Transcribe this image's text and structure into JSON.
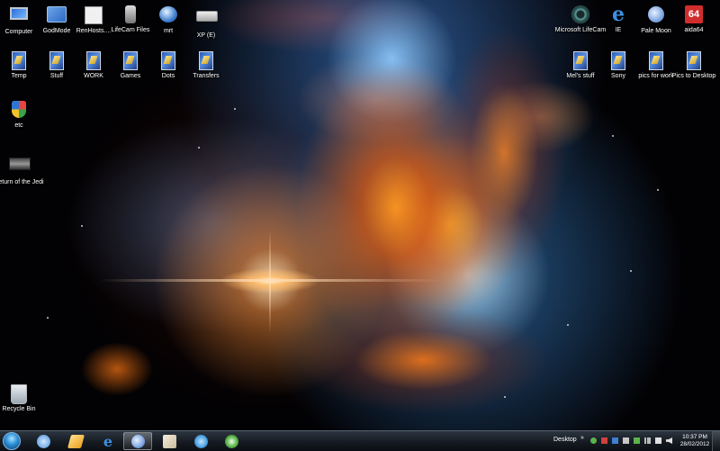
{
  "desktop": {
    "icons_top_row": [
      {
        "label": "Computer",
        "icon": "computer-icon"
      },
      {
        "label": "GodMode",
        "icon": "control-panel-icon"
      },
      {
        "label": "RenHosts....",
        "icon": "document-icon"
      },
      {
        "label": "LifeCam Files",
        "icon": "webcam-icon"
      },
      {
        "label": "mrt",
        "icon": "malware-removal-icon"
      },
      {
        "label": "XP (E)",
        "icon": "drive-icon"
      }
    ],
    "icons_second_row": [
      {
        "label": "Temp",
        "icon": "shortcut-icon"
      },
      {
        "label": "Stuff",
        "icon": "shortcut-icon"
      },
      {
        "label": "WORK",
        "icon": "shortcut-icon"
      },
      {
        "label": "Games",
        "icon": "shortcut-icon"
      },
      {
        "label": "Dots",
        "icon": "shortcut-icon"
      },
      {
        "label": "Transfers",
        "icon": "shortcut-icon"
      }
    ],
    "icon_etc": {
      "label": "etc",
      "icon": "windows-shield-icon"
    },
    "icon_return_of_the_jedi": {
      "label": "Return of the Jedi",
      "icon": "video-icon"
    },
    "icon_recycle_bin": {
      "label": "Recycle Bin",
      "icon": "recycle-bin-icon"
    },
    "icons_right_top": [
      {
        "label": "Microsoft LifeCam",
        "icon": "lifecam-icon"
      },
      {
        "label": "IE",
        "icon": "internet-explorer-icon"
      },
      {
        "label": "Pale Moon",
        "icon": "pale-moon-icon"
      },
      {
        "label": "aida64",
        "icon": "aida64-icon"
      }
    ],
    "icons_right_second": [
      {
        "label": "Mel's stuff",
        "icon": "shortcut-icon"
      },
      {
        "label": "Sony",
        "icon": "shortcut-icon"
      },
      {
        "label": "pics for work",
        "icon": "shortcut-icon"
      },
      {
        "label": "Pics to Desktop",
        "icon": "shortcut-icon"
      }
    ]
  },
  "taskbar": {
    "pinned": [
      {
        "name": "ccleaner",
        "icon": "ccleaner-icon",
        "color": "#4a8fd8"
      },
      {
        "name": "winamp",
        "icon": "winamp-icon",
        "color": "#e8a020"
      },
      {
        "name": "ie",
        "icon": "internet-explorer-icon",
        "color": "#3d8fe0"
      },
      {
        "name": "pale moon",
        "icon": "pale-moon-icon",
        "color": "#7ea6e0",
        "active": true
      },
      {
        "name": "paint",
        "icon": "paint-icon",
        "color": "#e8e0d0"
      },
      {
        "name": "windows update",
        "icon": "windows-update-icon",
        "color": "#4aa0e0"
      },
      {
        "name": "utorrent",
        "icon": "utorrent-icon",
        "color": "#5bb34a"
      }
    ],
    "tray_toolbar_label": "Desktop",
    "clock": {
      "time": "10:37 PM",
      "date": "28/02/2012"
    }
  }
}
